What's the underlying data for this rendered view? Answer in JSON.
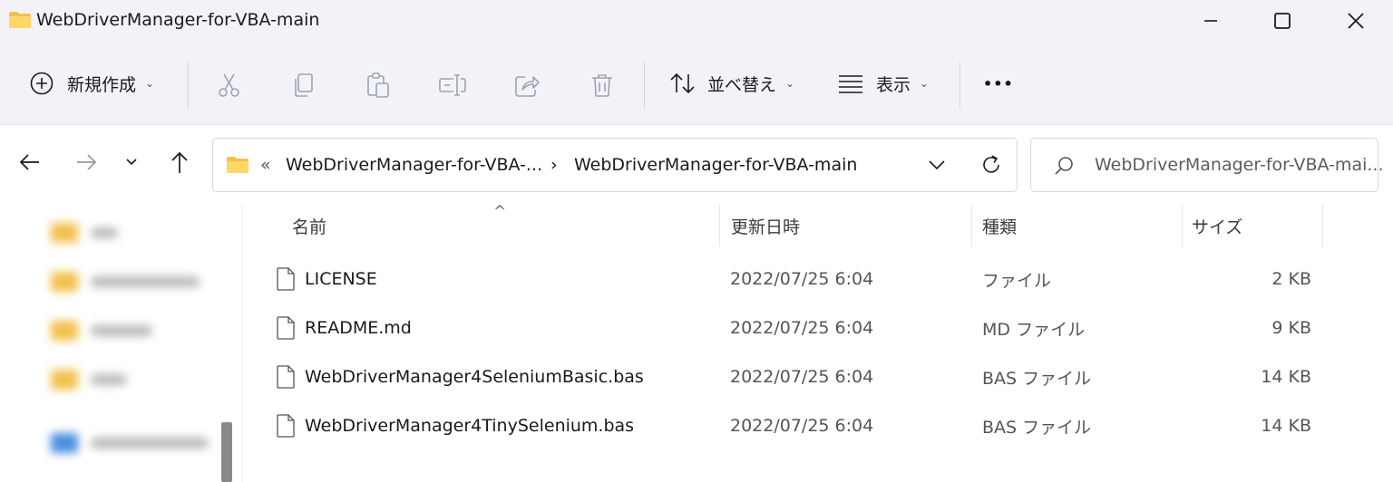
{
  "window": {
    "title": "WebDriverManager-for-VBA-main",
    "folder_icon": "folder-icon",
    "controls": [
      "minimize-icon",
      "maximize-icon",
      "close-icon"
    ]
  },
  "toolbar": {
    "new_label": "新規作成",
    "sort_label": "並べ替え",
    "view_label": "表示",
    "more_label": "•••",
    "actions": [
      "cut-icon",
      "copy-icon",
      "paste-icon",
      "rename-icon",
      "share-icon",
      "delete-icon"
    ]
  },
  "navigation": {
    "overflow_marker": "«",
    "crumbs": [
      "WebDriverManager-for-VBA-...",
      "WebDriverManager-for-VBA-main"
    ],
    "separator": "›",
    "search_placeholder": "WebDriverManager-for-VBA-mai..."
  },
  "filelist": {
    "sort_indicator": "^",
    "columns": [
      "名前",
      "更新日時",
      "種類",
      "サイズ"
    ],
    "rows": [
      {
        "name": "LICENSE",
        "modified": "2022/07/25 6:04",
        "type": "ファイル",
        "size": "2 KB"
      },
      {
        "name": "README.md",
        "modified": "2022/07/25 6:04",
        "type": "MD ファイル",
        "size": "9 KB"
      },
      {
        "name": "WebDriverManager4SeleniumBasic.bas",
        "modified": "2022/07/25 6:04",
        "type": "BAS ファイル",
        "size": "14 KB"
      },
      {
        "name": "WebDriverManager4TinySelenium.bas",
        "modified": "2022/07/25 6:04",
        "type": "BAS ファイル",
        "size": "14 KB"
      }
    ]
  },
  "colors": {
    "folder": "#f2c14e",
    "chrome_background": "#f3f3f7",
    "disabled_icon": "#9aa3b5"
  }
}
